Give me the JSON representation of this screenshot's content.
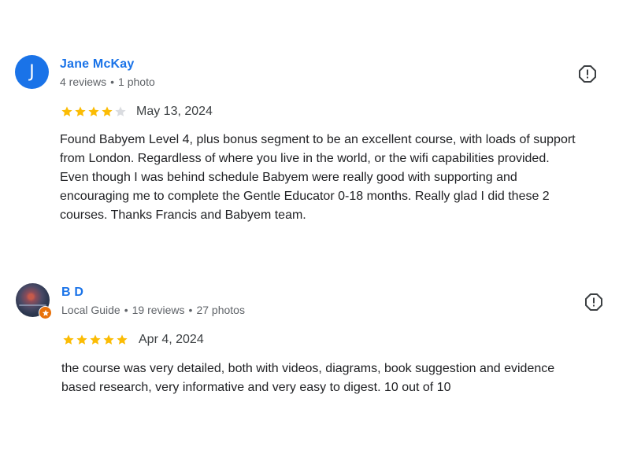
{
  "reviews": [
    {
      "avatar_letter": "J",
      "avatar_color": "#1a73e8",
      "name": "Jane McKay",
      "meta": [
        "4 reviews",
        "1 photo"
      ],
      "rating": 4,
      "max_rating": 5,
      "date": "May 13, 2024",
      "text": "Found Babyem Level 4, plus bonus segment to be an excellent course, with loads of support from London. Regardless of where you live in the world, or the wifi capabilities provided. Even though I was behind schedule Babyem were really good with supporting and encouraging me to complete the Gentle Educator 0-18 months. Really glad I did these 2 courses. Thanks Francis and Babyem team.",
      "text_lines": [
        "Found Babyem Level 4, plus bonus segment to be an excellent course, with loads of support",
        "from London. Regardless of where you live in the world, or the wifi capabilities provided.",
        "Even though I was behind schedule Babyem were really good with supporting and",
        "encouraging me to complete the Gentle Educator 0-18 months. Really glad I did these 2",
        "courses. Thanks Francis and Babyem team."
      ]
    },
    {
      "avatar_icon": "sunset-photo-avatar",
      "badge_icon": "local-guide-star-icon",
      "name": "B D",
      "meta": [
        "Local Guide",
        "19 reviews",
        "27 photos"
      ],
      "rating": 5,
      "max_rating": 5,
      "date": "Apr 4, 2024",
      "text_lines": [
        "the course was very detailed, both with videos, diagrams, book suggestion and evidence",
        "based research, very informative and very easy to digest. 10 out of 10"
      ]
    }
  ],
  "colors": {
    "star_filled": "#fbbc04",
    "star_empty": "#dadce0",
    "name_link": "#1a73e8",
    "meta_text": "#5f6368"
  }
}
